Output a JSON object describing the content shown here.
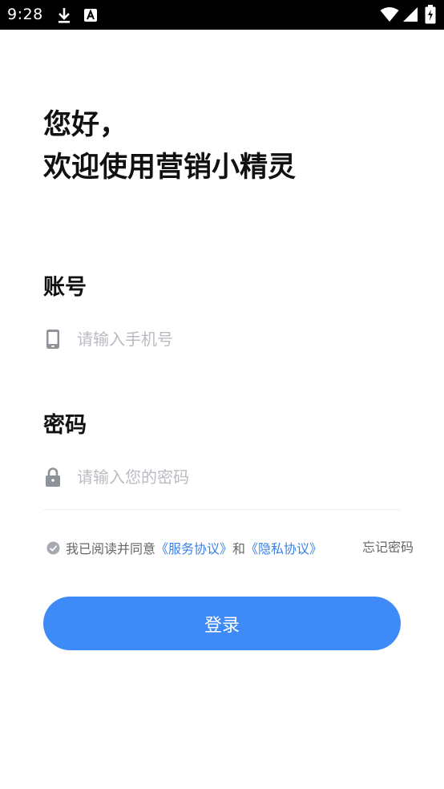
{
  "status_bar": {
    "time": "9:28",
    "icons": [
      "download-icon",
      "app-notification-icon",
      "wifi-icon",
      "signal-icon",
      "battery-icon"
    ]
  },
  "greeting": {
    "line1": "您好，",
    "line2": "欢迎使用营销小精灵"
  },
  "account": {
    "label": "账号",
    "placeholder": "请输入手机号",
    "value": "",
    "icon": "phone-icon"
  },
  "password": {
    "label": "密码",
    "placeholder": "请输入您的密码",
    "value": "",
    "icon": "lock-icon"
  },
  "agreement": {
    "prefix": "我已阅读并同意",
    "service_link": "《服务协议》",
    "conjunction": "和",
    "privacy_link": "《隐私协议》",
    "checked": false
  },
  "forgot_password": "忘记密码",
  "login_button": "登录",
  "colors": {
    "primary": "#3e8bf7",
    "link": "#3b82e8",
    "placeholder": "#b9bcc2",
    "icon_gray": "#8e9299"
  }
}
